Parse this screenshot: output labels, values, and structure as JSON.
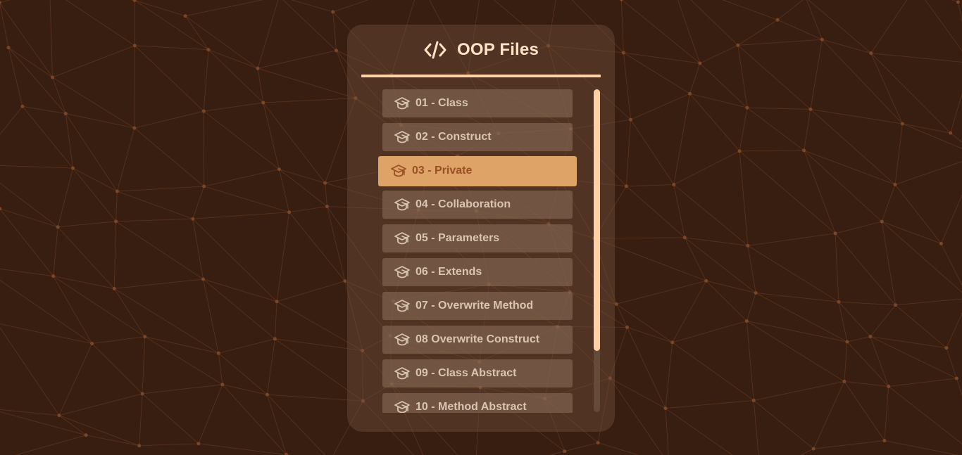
{
  "header": {
    "icon": "code-icon",
    "title": "OOP Files"
  },
  "files": {
    "icon": "graduation-cap-icon",
    "selected_index": 2,
    "items": [
      {
        "label": "01 - Class"
      },
      {
        "label": "02 - Construct"
      },
      {
        "label": "03 - Private"
      },
      {
        "label": "04 - Collaboration"
      },
      {
        "label": "05 - Parameters"
      },
      {
        "label": "06 - Extends"
      },
      {
        "label": "07 - Overwrite Method"
      },
      {
        "label": "08 Overwrite Construct"
      },
      {
        "label": "09 - Class Abstract"
      },
      {
        "label": "10 - Method Abstract"
      }
    ]
  },
  "scrollbar": {
    "position_fraction": 0.0,
    "visible_fraction": 0.81
  },
  "colors": {
    "background": "#381d11",
    "accent": "#ffd2a6",
    "selected_item": "#dea366",
    "selected_text": "#9a4f26",
    "item_text": "#d8c5b2",
    "title_text": "#fde4c6"
  }
}
